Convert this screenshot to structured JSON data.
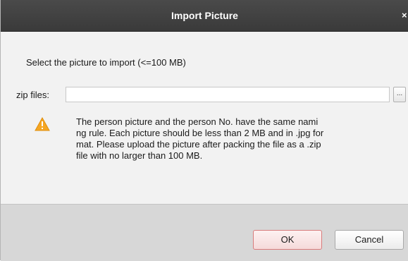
{
  "dialog": {
    "title": "Import Picture",
    "close_label": "×"
  },
  "content": {
    "instruction": "Select the picture to import (<=100 MB)",
    "zip_label": "zip files:",
    "zip_value": "",
    "browse_label": "...",
    "warning_icon": "warning-triangle-icon",
    "note_line1": "The person picture and the person No. have the same nami",
    "note_line2": "ng rule. Each picture should be less than 2 MB and in .jpg for",
    "note_line3": "mat. Please upload the picture after packing the file as a .zip",
    "note_line4": "file with no larger than 100 MB."
  },
  "footer": {
    "ok_label": "OK",
    "cancel_label": "Cancel"
  },
  "colors": {
    "titlebar": "#3f3f3f",
    "warning": "#f5a623",
    "ok_border": "#d87c7c"
  }
}
